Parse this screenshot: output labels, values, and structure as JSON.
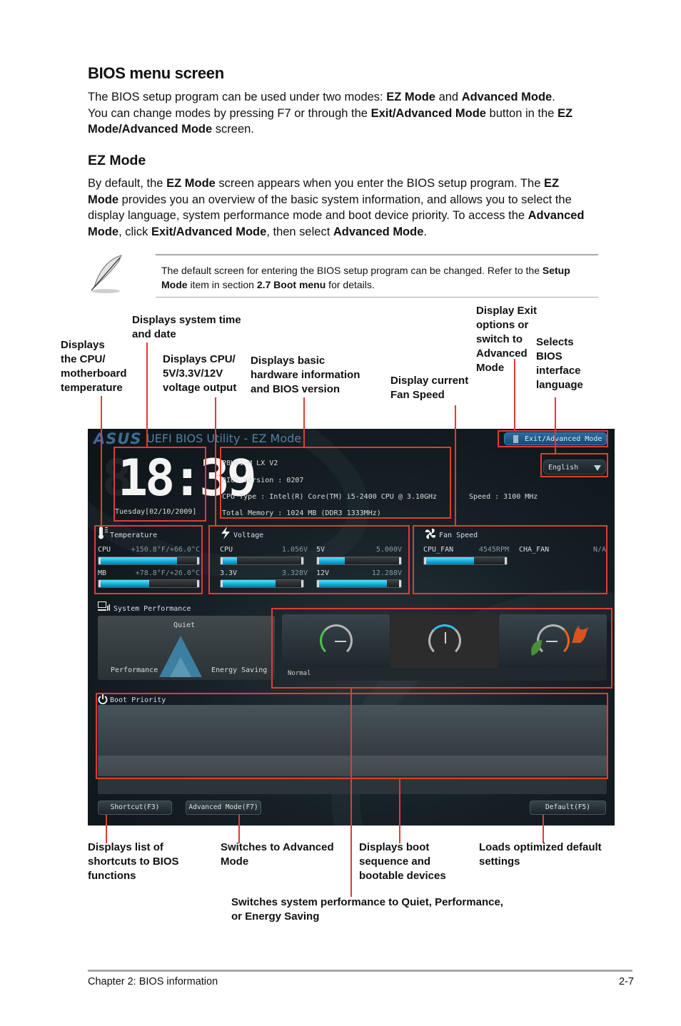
{
  "heading": "BIOS menu screen",
  "intro": {
    "line1_a": "The BIOS setup program can be used under two modes: ",
    "line1_b": "EZ Mode",
    "line1_c": " and ",
    "line1_d": "Advanced Mode",
    "line1_e": ".",
    "line2_a": "You can change modes by pressing F7 or through the ",
    "line2_b": "Exit/Advanced Mode",
    "line2_c": " button in the ",
    "line2_d": "EZ Mode/Advanced Mode",
    "line2_e": " screen."
  },
  "ez_heading": "EZ Mode",
  "ez_para": {
    "a": "By default, the ",
    "b": "EZ Mode",
    "c": " screen appears when you enter the BIOS setup program. The ",
    "d": "EZ Mode",
    "e": " provides you an overview of the basic system information, and allows you to select the display language, system performance mode and boot device priority. To access the ",
    "f": "Advanced Mode",
    "g": ", click ",
    "h": "Exit/Advanced Mode",
    "i": ", then select ",
    "j": "Advanced Mode",
    "k": "."
  },
  "note": {
    "icon": "feather-pen-icon",
    "a": "The default screen for entering the BIOS setup program can be changed. Refer to the ",
    "b": "Setup Mode",
    "c": " item in section ",
    "d": "2.7 Boot menu",
    "e": " for details."
  },
  "callouts": {
    "temperature": [
      "Displays",
      "the CPU/",
      "motherboard",
      "temperature"
    ],
    "time": [
      "Displays system time",
      "and date"
    ],
    "voltage": [
      "Displays CPU/",
      "5V/3.3V/12V",
      "voltage output"
    ],
    "hardware": [
      "Displays basic",
      "hardware information",
      "and BIOS version"
    ],
    "fan": [
      "Display current",
      "Fan Speed"
    ],
    "exit": [
      "Display Exit",
      "options or",
      "switch to",
      "Advanced",
      "Mode"
    ],
    "language": [
      "Selects",
      "BIOS",
      "interface",
      "language"
    ],
    "shortcut": [
      "Displays list of",
      "shortcuts to BIOS",
      "functions"
    ],
    "advanced": [
      "Switches to Advanced",
      "Mode"
    ],
    "boot": [
      "Displays boot",
      "sequence and",
      "bootable devices"
    ],
    "default": [
      "Loads optimized default",
      "settings"
    ],
    "performance": [
      "Switches system performance to Quiet, Performance,",
      "or Energy Saving"
    ]
  },
  "bios": {
    "logo": "ASUS",
    "title": "UEFI BIOS Utility - EZ Mode",
    "exit_button": "Exit/Advanced Mode",
    "language": "English",
    "clock": "18:39",
    "date": "Tuesday[02/10/2009]",
    "model": "P8H61-M LX V2",
    "bios_version": "BIOS Version : 0207",
    "cpu_type": "CPU Type : Intel(R) Core(TM) i5-2400 CPU @ 3.10GHz",
    "memory": "Total Memory : 1024 MB (DDR3 1333MHz)",
    "speed": "Speed : 3100 MHz",
    "temperature": {
      "title": "Temperature",
      "items": [
        {
          "label": "CPU",
          "value": "+150.8°F/+66.0°C",
          "fill": 0.78
        },
        {
          "label": "MB",
          "value": "+78.8°F/+26.0°C",
          "fill": 0.5
        }
      ]
    },
    "voltage": {
      "title": "Voltage",
      "items": [
        {
          "label": "CPU",
          "value": "1.056V",
          "fill": 0.2
        },
        {
          "label": "5V",
          "value": "5.000V",
          "fill": 0.33
        },
        {
          "label": "3.3V",
          "value": "3.328V",
          "fill": 0.66
        },
        {
          "label": "12V",
          "value": "12.288V",
          "fill": 0.83
        }
      ]
    },
    "fan": {
      "title": "Fan Speed",
      "items": [
        {
          "label": "CPU_FAN",
          "value": "4545RPM",
          "fill": 0.6
        },
        {
          "label": "CHA_FAN",
          "value": "N/A"
        }
      ]
    },
    "performance": {
      "title": "System Performance",
      "quiet": "Quiet",
      "performance": "Performance",
      "energy": "Energy Saving",
      "mode_label": "Normal",
      "modes": [
        "Quiet",
        "Normal",
        "Performance/Energy Saving"
      ],
      "active_index": 1
    },
    "boot": {
      "title": "Boot Priority"
    },
    "buttons": {
      "shortcut": "Shortcut(F3)",
      "advanced": "Advanced Mode(F7)",
      "default": "Default(F5)"
    }
  },
  "footer": {
    "chapter": "Chapter 2: BIOS information",
    "page": "2-7"
  }
}
